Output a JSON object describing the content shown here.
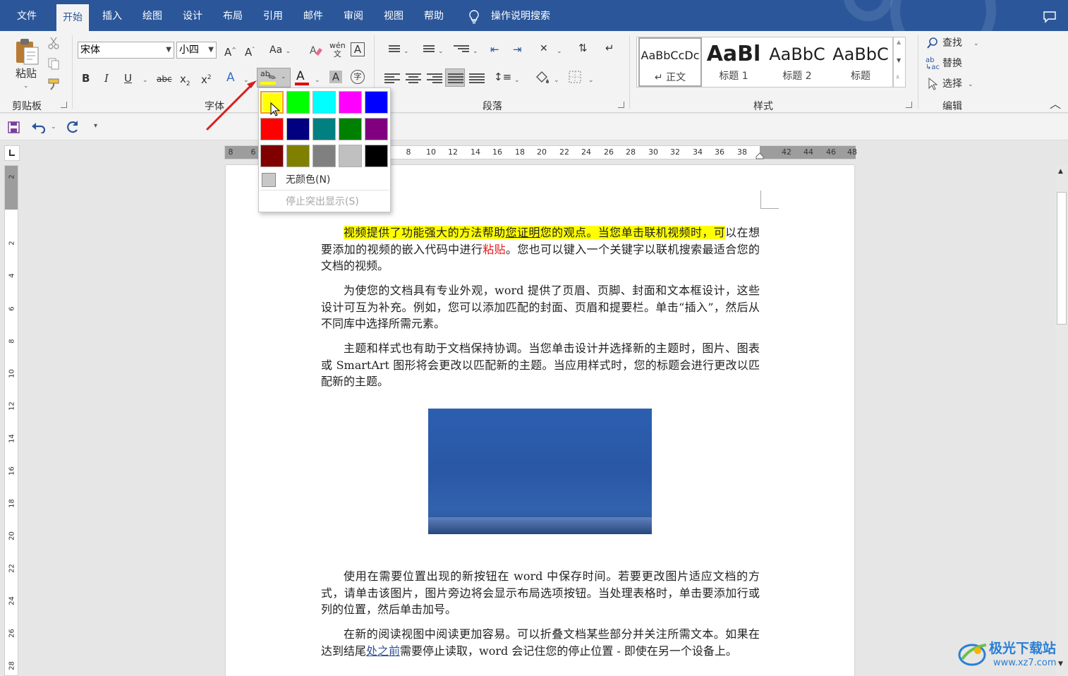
{
  "ribbon_tabs": [
    "文件",
    "开始",
    "插入",
    "绘图",
    "设计",
    "布局",
    "引用",
    "邮件",
    "审阅",
    "视图",
    "帮助"
  ],
  "tell_me": "操作说明搜索",
  "clipboard": {
    "paste_label": "粘贴",
    "group_label": "剪贴板"
  },
  "font": {
    "font_name": "宋体",
    "font_size": "小四",
    "group_label": "字体",
    "change_case": "Aa",
    "phonetic": "wén"
  },
  "paragraph": {
    "group_label": "段落"
  },
  "styles": {
    "group_label": "样式",
    "items": [
      {
        "preview": "AaBbCcDc",
        "name": "↵ 正文"
      },
      {
        "preview": "AaBl",
        "name": "标题 1"
      },
      {
        "preview": "AaBbC",
        "name": "标题 2"
      },
      {
        "preview": "AaBbC",
        "name": "标题"
      }
    ]
  },
  "editing": {
    "find": "查找",
    "replace": "替换",
    "select": "选择",
    "group_label": "编辑"
  },
  "ruler": {
    "h_left_ticks": [
      "8",
      "6"
    ],
    "h_ticks": [
      "8",
      "10",
      "12",
      "14",
      "16",
      "18",
      "20",
      "22",
      "24",
      "26",
      "28",
      "30",
      "32",
      "34",
      "36",
      "38"
    ],
    "h_right_ticks": [
      "42",
      "44",
      "46",
      "48"
    ],
    "v_ticks": [
      "2",
      "",
      "2",
      "4",
      "6",
      "8",
      "10",
      "12",
      "14",
      "16",
      "18",
      "20",
      "22",
      "24",
      "26",
      "28"
    ]
  },
  "highlight_menu": {
    "colors": [
      "#ffff00",
      "#00ff00",
      "#00ffff",
      "#ff00ff",
      "#0000ff",
      "#ff0000",
      "#000080",
      "#008080",
      "#008000",
      "#800080",
      "#800000",
      "#808000",
      "#808080",
      "#c0c0c0",
      "#000000"
    ],
    "selected_color": "#ffff00",
    "no_color": "无颜色(N)",
    "stop_highlight": "停止突出显示(S)"
  },
  "document": {
    "p1": {
      "a": "视频提供了功能强大的方法帮助",
      "b": "您证明",
      "c": "您的观点。当您单击联机视频时，可",
      "d": "以在想要添加的视频的嵌入代码中进行",
      "e": "粘贴",
      "f": "。您也可以键入一个关键字以联机搜索最适合您的文档的视频。"
    },
    "p2": "为使您的文档具有专业外观，word 提供了页眉、页脚、封面和文本框设计，这些设计可互为补充。例如，您可以添加匹配的封面、页眉和提要栏。单击“插入”，然后从不同库中选择所需元素。",
    "p3": "主题和样式也有助于文档保持协调。当您单击设计并选择新的主题时，图片、图表或 SmartArt 图形将会更改以匹配新的主题。当应用样式时，您的标题会进行更改以匹配新的主题。",
    "p4": "使用在需要位置出现的新按钮在 word 中保存时间。若要更改图片适应文档的方式，请单击该图片，图片旁边将会显示布局选项按钮。当处理表格时，单击要添加行或列的位置，然后单击加号。",
    "p5": {
      "a": "在新的阅读视图中阅读更加容易。可以折叠文档某些部分并关注所需文本。如果在达到结尾",
      "b": "处之前",
      "c": "需要停止读取，word 会记住您的停止位置 - 即使在另一个设备上。"
    }
  },
  "watermark": {
    "name": "极光下载站",
    "url": "www.xz7.com"
  }
}
